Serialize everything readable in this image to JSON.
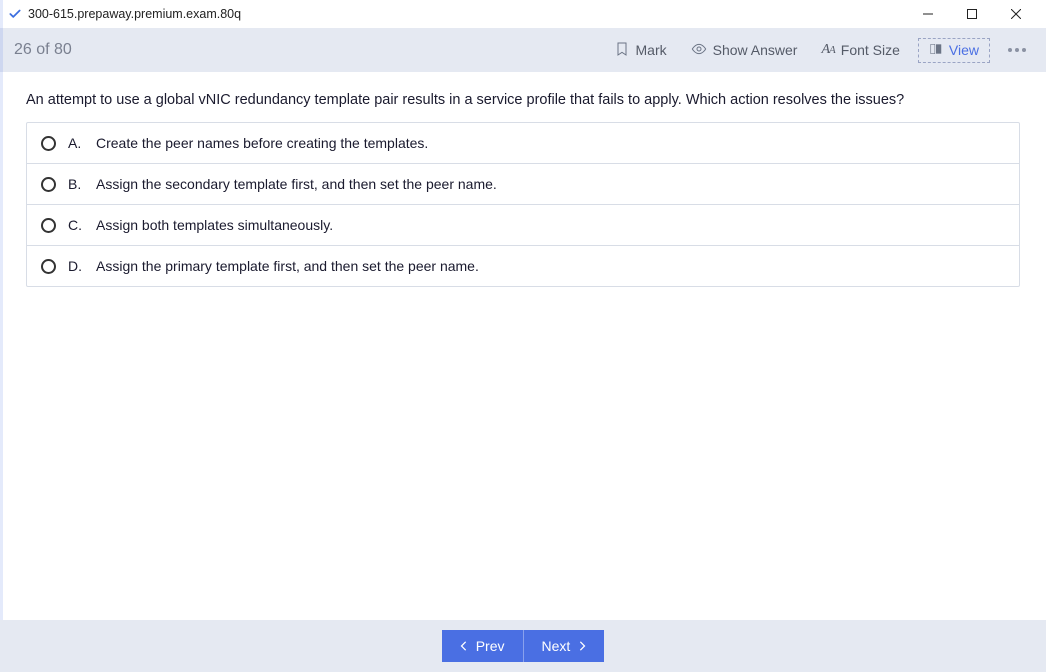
{
  "window": {
    "title": "300-615.prepaway.premium.exam.80q"
  },
  "toolbar": {
    "counter": "26 of 80",
    "mark_label": "Mark",
    "show_answer_label": "Show Answer",
    "font_size_label": "Font Size",
    "view_label": "View"
  },
  "question": {
    "text": "An attempt to use a global vNIC redundancy template pair results in a service profile that fails to apply. Which action resolves the issues?"
  },
  "options": [
    {
      "letter": "A.",
      "text": "Create the peer names before creating the templates."
    },
    {
      "letter": "B.",
      "text": "Assign the secondary template first, and then set the peer name."
    },
    {
      "letter": "C.",
      "text": "Assign both templates simultaneously."
    },
    {
      "letter": "D.",
      "text": "Assign the primary template first, and then set the peer name."
    }
  ],
  "footer": {
    "prev_label": "Prev",
    "next_label": "Next"
  }
}
